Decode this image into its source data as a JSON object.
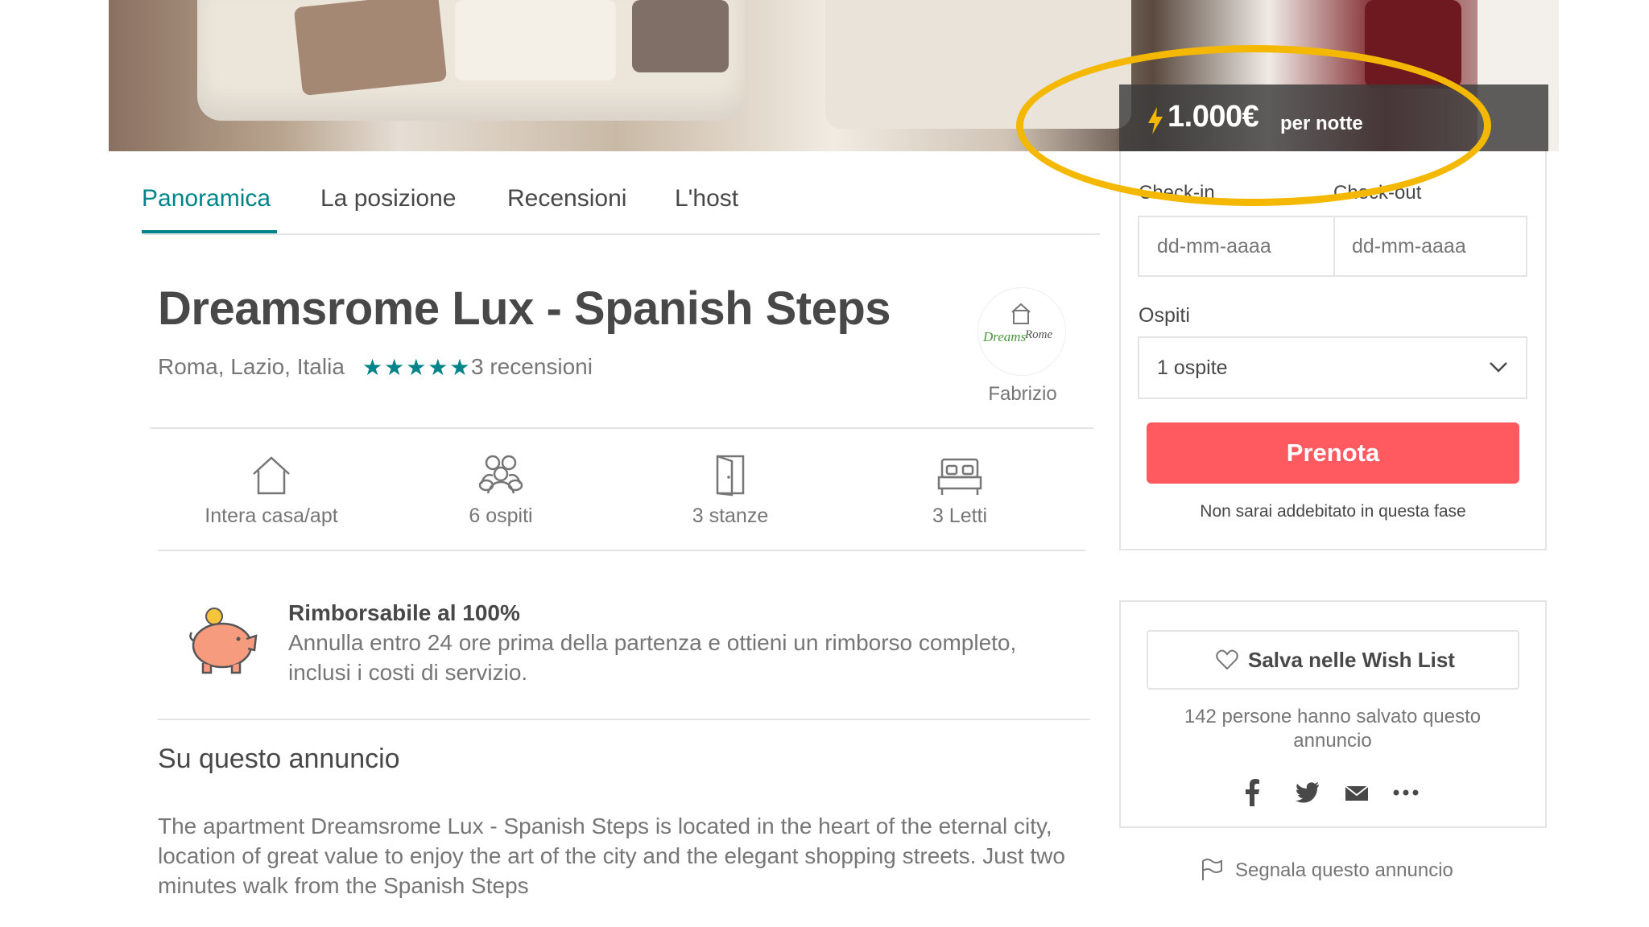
{
  "listing": {
    "price": "1.000€",
    "price_unit": "per notte",
    "title": "Dreamsrome Lux - Spanish Steps",
    "location": "Roma, Lazio, Italia",
    "stars": "★★★★★",
    "rating": 5,
    "reviews": "3 recensioni"
  },
  "tabs": [
    "Panoramica",
    "La posizione",
    "Recensioni",
    "L'host"
  ],
  "host": {
    "name": "Fabrizio",
    "logo_text_1": "Dreams",
    "logo_text_2": "Rome"
  },
  "amenities": [
    {
      "icon": "home-icon",
      "label": "Intera casa/apt"
    },
    {
      "icon": "guests-icon",
      "label": "6 ospiti"
    },
    {
      "icon": "door-icon",
      "label": "3 stanze"
    },
    {
      "icon": "bed-icon",
      "label": "3 Letti"
    }
  ],
  "refund": {
    "title": "Rimborsabile al 100%",
    "text": "Annulla entro 24 ore prima della partenza e ottieni un rimborso completo, inclusi i costi di servizio."
  },
  "about": {
    "title": "Su questo annuncio",
    "text": "The apartment Dreamsrome Lux - Spanish Steps is located in the heart of the eternal city, location of great value to enjoy the art of the city and the elegant shopping streets. Just two minutes walk from the Spanish Steps"
  },
  "booking": {
    "checkin_label": "Check-in",
    "checkout_label": "Check-out",
    "checkin_placeholder": "dd-mm-aaaa",
    "checkout_placeholder": "dd-mm-aaaa",
    "guests_label": "Ospiti",
    "guests_value": "1 ospite",
    "book_label": "Prenota",
    "no_charge": "Non sarai addebitato in questa fase"
  },
  "wishlist": {
    "button_label": "Salva nelle Wish List",
    "saved_text": "142 persone hanno salvato questo annuncio"
  },
  "share": [
    "facebook-icon",
    "twitter-icon",
    "email-icon",
    "more-icon"
  ],
  "report_label": "Segnala questo annuncio",
  "colors": {
    "accent": "#008489",
    "book_button": "#ff5a5f",
    "highlight": "#f5b800",
    "price_bar": "#3c3c3c"
  }
}
